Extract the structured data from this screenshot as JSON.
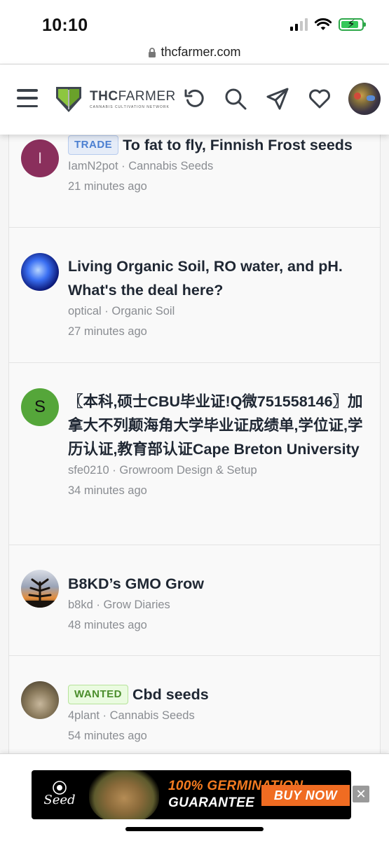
{
  "status_bar": {
    "time": "10:10"
  },
  "browser": {
    "url": "thcfarmer.com"
  },
  "header": {
    "logo_main_bold": "THC",
    "logo_main_rest": "FARMER",
    "logo_sub": "CANNABIS CULTIVATION NETWORK"
  },
  "feed": {
    "items": [
      {
        "badge": "TRADE",
        "title": "To fat to fly, Finnish Frost seeds",
        "author": "IamN2pot",
        "forum": "Cannabis Seeds",
        "time": "21 minutes ago",
        "avatar_letter": "I"
      },
      {
        "badge": "",
        "title": "Living Organic Soil, RO water, and pH. What's the deal here?",
        "author": "optical",
        "forum": "Organic Soil",
        "time": "27 minutes ago",
        "avatar_letter": ""
      },
      {
        "badge": "",
        "title": "〖本科,硕士CBU毕业证!Q微751558146〗加拿大不列颠海角大学毕业证成绩单,学位证,学历认证,教育部认证Cape Breton University",
        "author": "sfe0210",
        "forum": "Growroom Design & Setup",
        "time": "34 minutes ago",
        "avatar_letter": "S"
      },
      {
        "badge": "",
        "title": "B8KD’s GMO Grow",
        "author": "b8kd",
        "forum": "Grow Diaries",
        "time": "48 minutes ago",
        "avatar_letter": ""
      },
      {
        "badge": "WANTED",
        "title": "Cbd seeds",
        "author": "4plant",
        "forum": "Cannabis Seeds",
        "time": "54 minutes ago",
        "avatar_letter": ""
      }
    ],
    "meta_separator": " · "
  },
  "ad": {
    "brand": "Seed",
    "headline": "100% GERMINATION",
    "subline": "GUARANTEE",
    "cta": "BUY NOW",
    "close": "✕"
  },
  "colors": {
    "trade_badge": "#4b7fd1",
    "wanted_badge": "#4b8e2c",
    "ad_accent": "#f06c22"
  }
}
